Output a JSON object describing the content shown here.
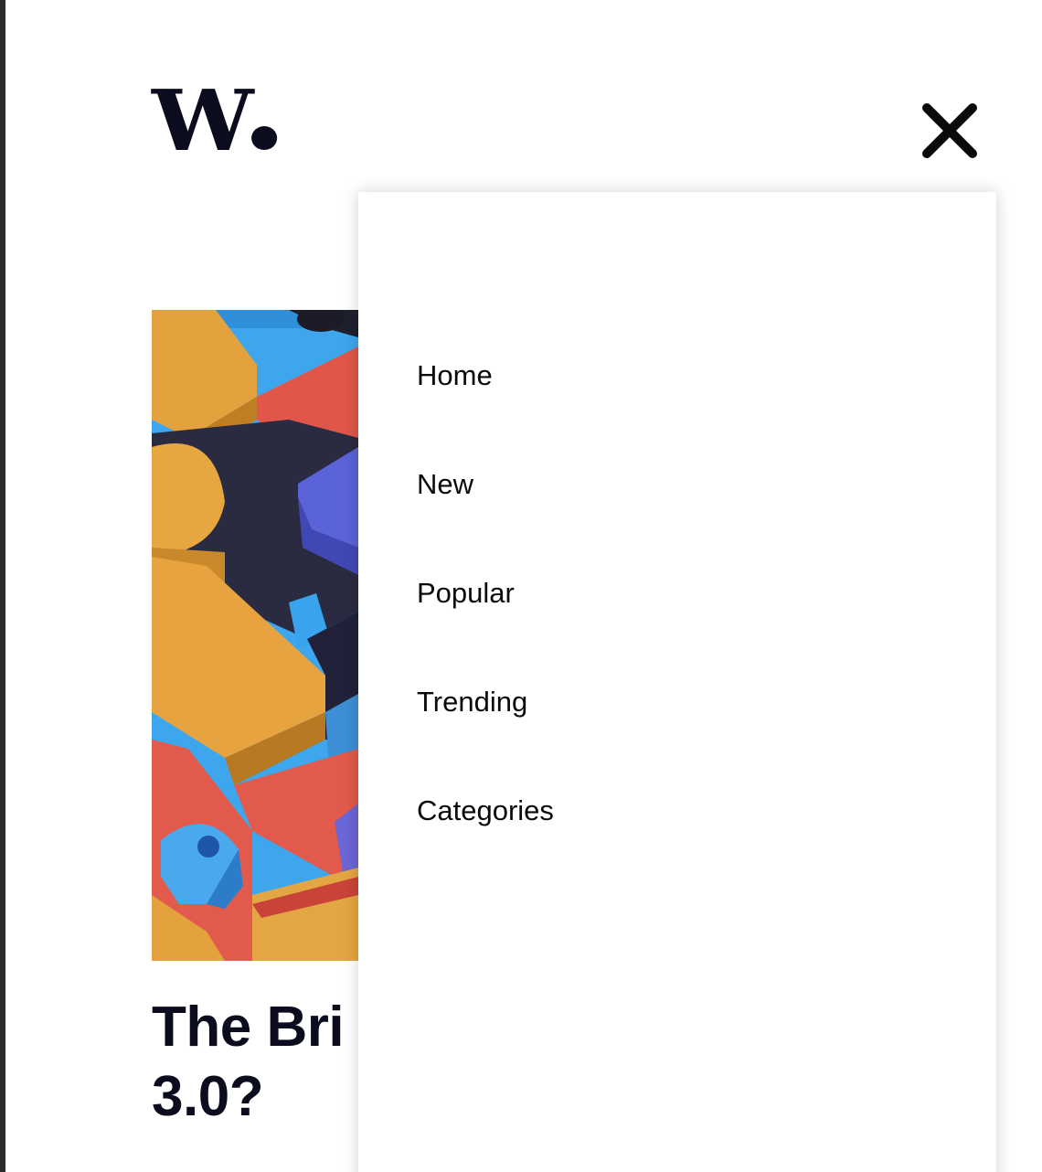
{
  "brand": {
    "logo_text": "W",
    "color": "#0b0d1f"
  },
  "header": {
    "close_icon": "close-icon"
  },
  "article": {
    "title": "The Bri 3.0?",
    "title_line1": "The Bri",
    "title_line2": "3.0?"
  },
  "menu": {
    "items": [
      {
        "label": "Home"
      },
      {
        "label": "New"
      },
      {
        "label": "Popular"
      },
      {
        "label": "Trending"
      },
      {
        "label": "Categories"
      }
    ]
  },
  "colors": {
    "text": "#0a0a0a",
    "brand_dark": "#0b0d1f",
    "panel": "#ffffff"
  }
}
